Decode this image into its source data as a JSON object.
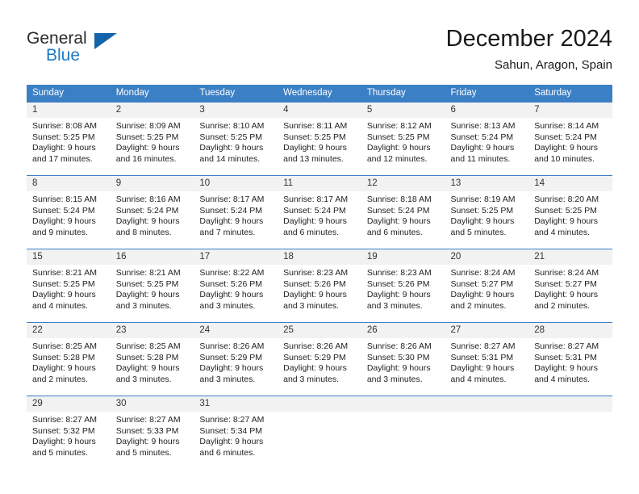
{
  "logo": {
    "word1": "General",
    "word2": "Blue",
    "triangle_color": "#1464aa",
    "blue_color": "#1f7ac4"
  },
  "header": {
    "title": "December 2024",
    "subtitle": "Sahun, Aragon, Spain"
  },
  "theme": {
    "header_blue": "#3b7fc4",
    "daynum_gray": "#f2f2f2",
    "text": "#222222"
  },
  "weekdays": [
    "Sunday",
    "Monday",
    "Tuesday",
    "Wednesday",
    "Thursday",
    "Friday",
    "Saturday"
  ],
  "weeks": [
    [
      {
        "day": "1",
        "sunrise": "Sunrise: 8:08 AM",
        "sunset": "Sunset: 5:25 PM",
        "daylight1": "Daylight: 9 hours",
        "daylight2": "and 17 minutes."
      },
      {
        "day": "2",
        "sunrise": "Sunrise: 8:09 AM",
        "sunset": "Sunset: 5:25 PM",
        "daylight1": "Daylight: 9 hours",
        "daylight2": "and 16 minutes."
      },
      {
        "day": "3",
        "sunrise": "Sunrise: 8:10 AM",
        "sunset": "Sunset: 5:25 PM",
        "daylight1": "Daylight: 9 hours",
        "daylight2": "and 14 minutes."
      },
      {
        "day": "4",
        "sunrise": "Sunrise: 8:11 AM",
        "sunset": "Sunset: 5:25 PM",
        "daylight1": "Daylight: 9 hours",
        "daylight2": "and 13 minutes."
      },
      {
        "day": "5",
        "sunrise": "Sunrise: 8:12 AM",
        "sunset": "Sunset: 5:25 PM",
        "daylight1": "Daylight: 9 hours",
        "daylight2": "and 12 minutes."
      },
      {
        "day": "6",
        "sunrise": "Sunrise: 8:13 AM",
        "sunset": "Sunset: 5:24 PM",
        "daylight1": "Daylight: 9 hours",
        "daylight2": "and 11 minutes."
      },
      {
        "day": "7",
        "sunrise": "Sunrise: 8:14 AM",
        "sunset": "Sunset: 5:24 PM",
        "daylight1": "Daylight: 9 hours",
        "daylight2": "and 10 minutes."
      }
    ],
    [
      {
        "day": "8",
        "sunrise": "Sunrise: 8:15 AM",
        "sunset": "Sunset: 5:24 PM",
        "daylight1": "Daylight: 9 hours",
        "daylight2": "and 9 minutes."
      },
      {
        "day": "9",
        "sunrise": "Sunrise: 8:16 AM",
        "sunset": "Sunset: 5:24 PM",
        "daylight1": "Daylight: 9 hours",
        "daylight2": "and 8 minutes."
      },
      {
        "day": "10",
        "sunrise": "Sunrise: 8:17 AM",
        "sunset": "Sunset: 5:24 PM",
        "daylight1": "Daylight: 9 hours",
        "daylight2": "and 7 minutes."
      },
      {
        "day": "11",
        "sunrise": "Sunrise: 8:17 AM",
        "sunset": "Sunset: 5:24 PM",
        "daylight1": "Daylight: 9 hours",
        "daylight2": "and 6 minutes."
      },
      {
        "day": "12",
        "sunrise": "Sunrise: 8:18 AM",
        "sunset": "Sunset: 5:24 PM",
        "daylight1": "Daylight: 9 hours",
        "daylight2": "and 6 minutes."
      },
      {
        "day": "13",
        "sunrise": "Sunrise: 8:19 AM",
        "sunset": "Sunset: 5:25 PM",
        "daylight1": "Daylight: 9 hours",
        "daylight2": "and 5 minutes."
      },
      {
        "day": "14",
        "sunrise": "Sunrise: 8:20 AM",
        "sunset": "Sunset: 5:25 PM",
        "daylight1": "Daylight: 9 hours",
        "daylight2": "and 4 minutes."
      }
    ],
    [
      {
        "day": "15",
        "sunrise": "Sunrise: 8:21 AM",
        "sunset": "Sunset: 5:25 PM",
        "daylight1": "Daylight: 9 hours",
        "daylight2": "and 4 minutes."
      },
      {
        "day": "16",
        "sunrise": "Sunrise: 8:21 AM",
        "sunset": "Sunset: 5:25 PM",
        "daylight1": "Daylight: 9 hours",
        "daylight2": "and 3 minutes."
      },
      {
        "day": "17",
        "sunrise": "Sunrise: 8:22 AM",
        "sunset": "Sunset: 5:26 PM",
        "daylight1": "Daylight: 9 hours",
        "daylight2": "and 3 minutes."
      },
      {
        "day": "18",
        "sunrise": "Sunrise: 8:23 AM",
        "sunset": "Sunset: 5:26 PM",
        "daylight1": "Daylight: 9 hours",
        "daylight2": "and 3 minutes."
      },
      {
        "day": "19",
        "sunrise": "Sunrise: 8:23 AM",
        "sunset": "Sunset: 5:26 PM",
        "daylight1": "Daylight: 9 hours",
        "daylight2": "and 3 minutes."
      },
      {
        "day": "20",
        "sunrise": "Sunrise: 8:24 AM",
        "sunset": "Sunset: 5:27 PM",
        "daylight1": "Daylight: 9 hours",
        "daylight2": "and 2 minutes."
      },
      {
        "day": "21",
        "sunrise": "Sunrise: 8:24 AM",
        "sunset": "Sunset: 5:27 PM",
        "daylight1": "Daylight: 9 hours",
        "daylight2": "and 2 minutes."
      }
    ],
    [
      {
        "day": "22",
        "sunrise": "Sunrise: 8:25 AM",
        "sunset": "Sunset: 5:28 PM",
        "daylight1": "Daylight: 9 hours",
        "daylight2": "and 2 minutes."
      },
      {
        "day": "23",
        "sunrise": "Sunrise: 8:25 AM",
        "sunset": "Sunset: 5:28 PM",
        "daylight1": "Daylight: 9 hours",
        "daylight2": "and 3 minutes."
      },
      {
        "day": "24",
        "sunrise": "Sunrise: 8:26 AM",
        "sunset": "Sunset: 5:29 PM",
        "daylight1": "Daylight: 9 hours",
        "daylight2": "and 3 minutes."
      },
      {
        "day": "25",
        "sunrise": "Sunrise: 8:26 AM",
        "sunset": "Sunset: 5:29 PM",
        "daylight1": "Daylight: 9 hours",
        "daylight2": "and 3 minutes."
      },
      {
        "day": "26",
        "sunrise": "Sunrise: 8:26 AM",
        "sunset": "Sunset: 5:30 PM",
        "daylight1": "Daylight: 9 hours",
        "daylight2": "and 3 minutes."
      },
      {
        "day": "27",
        "sunrise": "Sunrise: 8:27 AM",
        "sunset": "Sunset: 5:31 PM",
        "daylight1": "Daylight: 9 hours",
        "daylight2": "and 4 minutes."
      },
      {
        "day": "28",
        "sunrise": "Sunrise: 8:27 AM",
        "sunset": "Sunset: 5:31 PM",
        "daylight1": "Daylight: 9 hours",
        "daylight2": "and 4 minutes."
      }
    ],
    [
      {
        "day": "29",
        "sunrise": "Sunrise: 8:27 AM",
        "sunset": "Sunset: 5:32 PM",
        "daylight1": "Daylight: 9 hours",
        "daylight2": "and 5 minutes."
      },
      {
        "day": "30",
        "sunrise": "Sunrise: 8:27 AM",
        "sunset": "Sunset: 5:33 PM",
        "daylight1": "Daylight: 9 hours",
        "daylight2": "and 5 minutes."
      },
      {
        "day": "31",
        "sunrise": "Sunrise: 8:27 AM",
        "sunset": "Sunset: 5:34 PM",
        "daylight1": "Daylight: 9 hours",
        "daylight2": "and 6 minutes."
      },
      {
        "day": "",
        "sunrise": "",
        "sunset": "",
        "daylight1": "",
        "daylight2": ""
      },
      {
        "day": "",
        "sunrise": "",
        "sunset": "",
        "daylight1": "",
        "daylight2": ""
      },
      {
        "day": "",
        "sunrise": "",
        "sunset": "",
        "daylight1": "",
        "daylight2": ""
      },
      {
        "day": "",
        "sunrise": "",
        "sunset": "",
        "daylight1": "",
        "daylight2": ""
      }
    ]
  ]
}
